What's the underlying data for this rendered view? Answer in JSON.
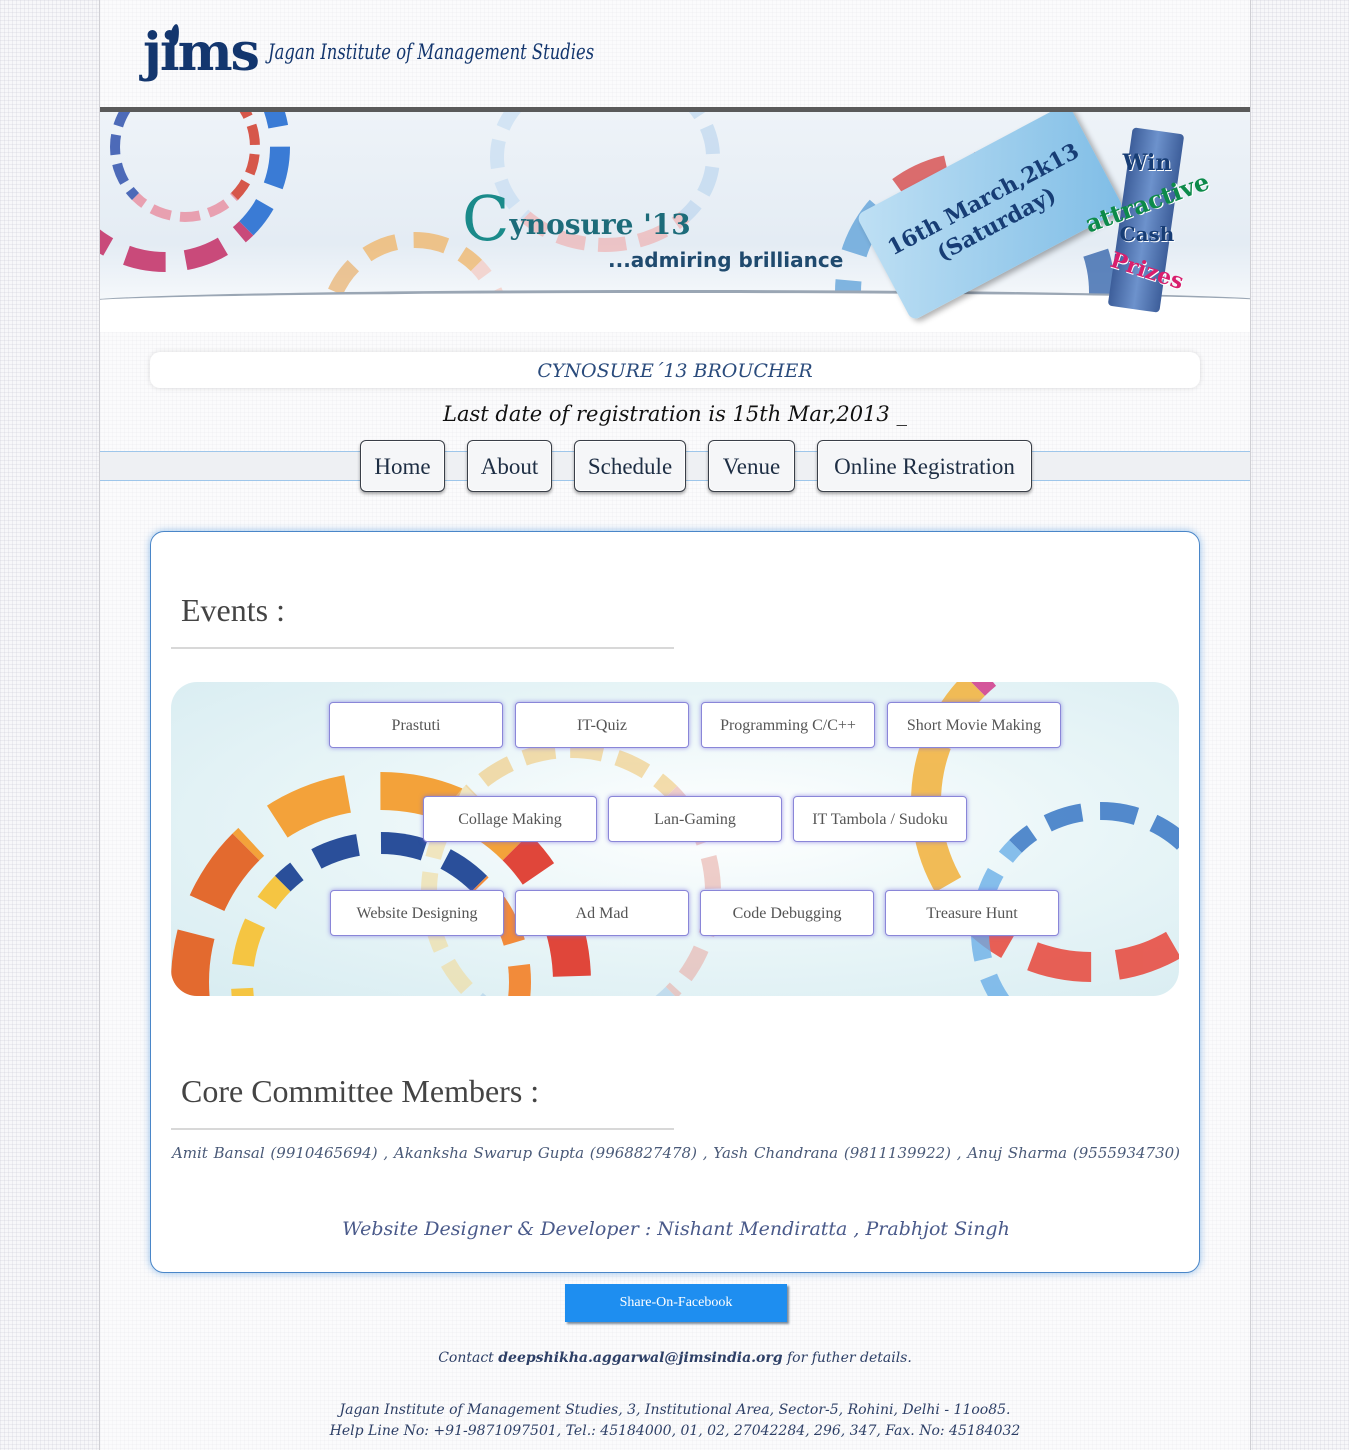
{
  "header": {
    "logo_mark": "jims",
    "logo_text": "Jagan Institute of Management Studies"
  },
  "banner": {
    "title_initial": "C",
    "title_rest": "ynosure '13",
    "tagline": "...admiring brilliance",
    "date_line1": "16th March,2k13",
    "date_line2": "(Saturday)",
    "prize": [
      "Win",
      "attractive",
      "Cash",
      "Prizes"
    ]
  },
  "brochure_label": "CYNOSURE´13 BROUCHER",
  "last_date": "Last date of registration is 15th Mar,2013 _",
  "nav": {
    "items": [
      {
        "label": "Home"
      },
      {
        "label": "About"
      },
      {
        "label": "Schedule"
      },
      {
        "label": "Venue"
      },
      {
        "label": "Online Registration"
      }
    ]
  },
  "events": {
    "heading": "Events :",
    "items": [
      "Prastuti",
      "IT-Quiz",
      "Programming C/C++",
      "Short Movie Making",
      "Collage Making",
      "Lan-Gaming",
      "IT Tambola / Sudoku",
      "Website Designing",
      "Ad Mad",
      "Code Debugging",
      "Treasure Hunt"
    ]
  },
  "committee": {
    "heading": "Core Committee Members :",
    "members": "Amit Bansal (9910465694) ,      Akanksha Swarup Gupta (9968827478) ,      Yash Chandrana (9811139922) ,      Anuj Sharma (9555934730)"
  },
  "credits": "Website Designer & Developer : Nishant Mendiratta , Prabhjot Singh",
  "share_button": "Share-On-Facebook",
  "contact": {
    "prefix": "Contact",
    "email": "deepshikha.aggarwal@jimsindia.org",
    "suffix": "for futher details."
  },
  "address": {
    "line1": "Jagan Institute of Management Studies, 3, Institutional Area, Sector-5, Rohini, Delhi - 11oo85.",
    "line2": "Help Line No: +91-9871097501, Tel.: 45184000, 01, 02, 27042284, 296, 347, Fax. No: 45184032"
  },
  "colors": {
    "accent": "#1e8ef0",
    "brand_navy": "#13366e",
    "panel_border": "#4a86c8"
  }
}
